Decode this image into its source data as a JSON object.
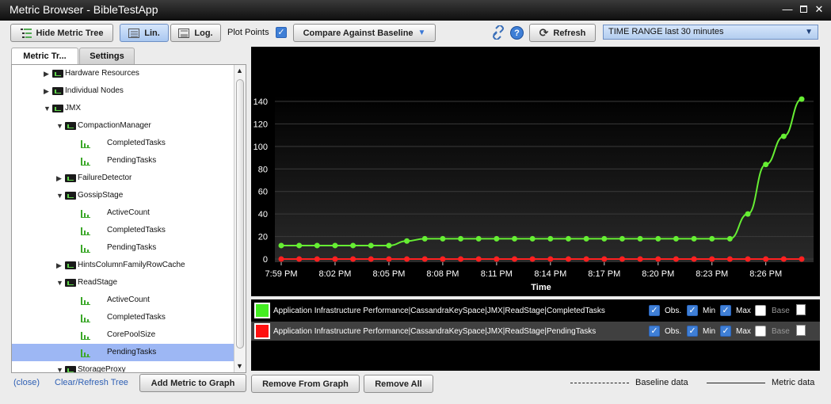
{
  "window": {
    "title": "Metric Browser - BibleTestApp"
  },
  "toolbar": {
    "hide_tree": "Hide Metric Tree",
    "lin": "Lin.",
    "log": "Log.",
    "plot_points": "Plot Points",
    "compare": "Compare Against Baseline",
    "refresh": "Refresh",
    "time_range": "TIME RANGE last 30 minutes"
  },
  "tabs": {
    "metric_tree": "Metric Tr...",
    "settings": "Settings"
  },
  "tree": {
    "rows": [
      {
        "label": "Hardware Resources",
        "type": "folder",
        "level": 1,
        "state": "collapsed"
      },
      {
        "label": "Individual Nodes",
        "type": "folder",
        "level": 1,
        "state": "collapsed"
      },
      {
        "label": "JMX",
        "type": "folder",
        "level": 1,
        "state": "expanded"
      },
      {
        "label": "CompactionManager",
        "type": "folder",
        "level": 2,
        "state": "expanded"
      },
      {
        "label": "CompletedTasks",
        "type": "metric",
        "level": 3
      },
      {
        "label": "PendingTasks",
        "type": "metric",
        "level": 3
      },
      {
        "label": "FailureDetector",
        "type": "folder",
        "level": 2,
        "state": "collapsed"
      },
      {
        "label": "GossipStage",
        "type": "folder",
        "level": 2,
        "state": "expanded"
      },
      {
        "label": "ActiveCount",
        "type": "metric",
        "level": 3
      },
      {
        "label": "CompletedTasks",
        "type": "metric",
        "level": 3
      },
      {
        "label": "PendingTasks",
        "type": "metric",
        "level": 3
      },
      {
        "label": "HintsColumnFamilyRowCache",
        "type": "folder",
        "level": 2,
        "state": "collapsed"
      },
      {
        "label": "ReadStage",
        "type": "folder",
        "level": 2,
        "state": "expanded"
      },
      {
        "label": "ActiveCount",
        "type": "metric",
        "level": 3
      },
      {
        "label": "CompletedTasks",
        "type": "metric",
        "level": 3
      },
      {
        "label": "CorePoolSize",
        "type": "metric",
        "level": 3
      },
      {
        "label": "PendingTasks",
        "type": "metric",
        "level": 3,
        "selected": true
      },
      {
        "label": "StorageProxy",
        "type": "folder",
        "level": 2,
        "state": "expanded"
      }
    ]
  },
  "tree_footer": {
    "close": "(close)",
    "clear": "Clear/Refresh Tree",
    "add": "Add Metric to Graph"
  },
  "actions": {
    "remove_from_graph": "Remove From Graph",
    "remove_all": "Remove All"
  },
  "chart_data": {
    "type": "line",
    "title": "",
    "xlabel": "Time",
    "ylabel": "",
    "x_tick_labels": [
      "7:59 PM",
      "8:02 PM",
      "8:05 PM",
      "8:08 PM",
      "8:11 PM",
      "8:14 PM",
      "8:17 PM",
      "8:20 PM",
      "8:23 PM",
      "8:26 PM"
    ],
    "y_ticks": [
      0,
      20,
      40,
      60,
      80,
      100,
      120,
      140
    ],
    "ylim": [
      0,
      150
    ],
    "grid": true,
    "series": [
      {
        "name": "Application Infrastructure Performance|CassandraKeySpace|JMX|ReadStage|CompletedTasks",
        "color": "#66ee33",
        "x": [
          "7:59 PM",
          "8:00 PM",
          "8:01 PM",
          "8:02 PM",
          "8:03 PM",
          "8:04 PM",
          "8:05 PM",
          "8:06 PM",
          "8:07 PM",
          "8:08 PM",
          "8:09 PM",
          "8:10 PM",
          "8:11 PM",
          "8:12 PM",
          "8:13 PM",
          "8:14 PM",
          "8:15 PM",
          "8:16 PM",
          "8:17 PM",
          "8:18 PM",
          "8:19 PM",
          "8:20 PM",
          "8:21 PM",
          "8:22 PM",
          "8:23 PM",
          "8:24 PM",
          "8:25 PM",
          "8:26 PM",
          "8:27 PM",
          "8:28 PM"
        ],
        "values": [
          12,
          12,
          12,
          12,
          12,
          12,
          12,
          16,
          18,
          18,
          18,
          18,
          18,
          18,
          18,
          18,
          18,
          18,
          18,
          18,
          18,
          18,
          18,
          18,
          18,
          18,
          40,
          84,
          109,
          142
        ]
      },
      {
        "name": "Application Infrastructure Performance|CassandraKeySpace|JMX|ReadStage|PendingTasks",
        "color": "#ff2020",
        "x": [
          "7:59 PM",
          "8:00 PM",
          "8:01 PM",
          "8:02 PM",
          "8:03 PM",
          "8:04 PM",
          "8:05 PM",
          "8:06 PM",
          "8:07 PM",
          "8:08 PM",
          "8:09 PM",
          "8:10 PM",
          "8:11 PM",
          "8:12 PM",
          "8:13 PM",
          "8:14 PM",
          "8:15 PM",
          "8:16 PM",
          "8:17 PM",
          "8:18 PM",
          "8:19 PM",
          "8:20 PM",
          "8:21 PM",
          "8:22 PM",
          "8:23 PM",
          "8:24 PM",
          "8:25 PM",
          "8:26 PM",
          "8:27 PM",
          "8:28 PM"
        ],
        "values": [
          0,
          0,
          0,
          0,
          0,
          0,
          0,
          0,
          0,
          0,
          0,
          0,
          0,
          0,
          0,
          0,
          0,
          0,
          0,
          0,
          0,
          0,
          0,
          0,
          0,
          0,
          0,
          0,
          0,
          0
        ]
      }
    ]
  },
  "legend": {
    "rows": [
      {
        "name": "Application Infrastructure Performance|CassandraKeySpace|JMX|ReadStage|CompletedTasks",
        "color": "#44ee22",
        "obs": true,
        "min": true,
        "max": true,
        "base": false
      },
      {
        "name": "Application Infrastructure Performance|CassandraKeySpace|JMX|ReadStage|PendingTasks",
        "color": "#ff1010",
        "obs": true,
        "min": true,
        "max": true,
        "base": false
      }
    ],
    "obs_label": "Obs.",
    "min_label": "Min",
    "max_label": "Max",
    "base_label": "Base"
  },
  "footer": {
    "baseline": "Baseline data",
    "metric": "Metric data"
  }
}
